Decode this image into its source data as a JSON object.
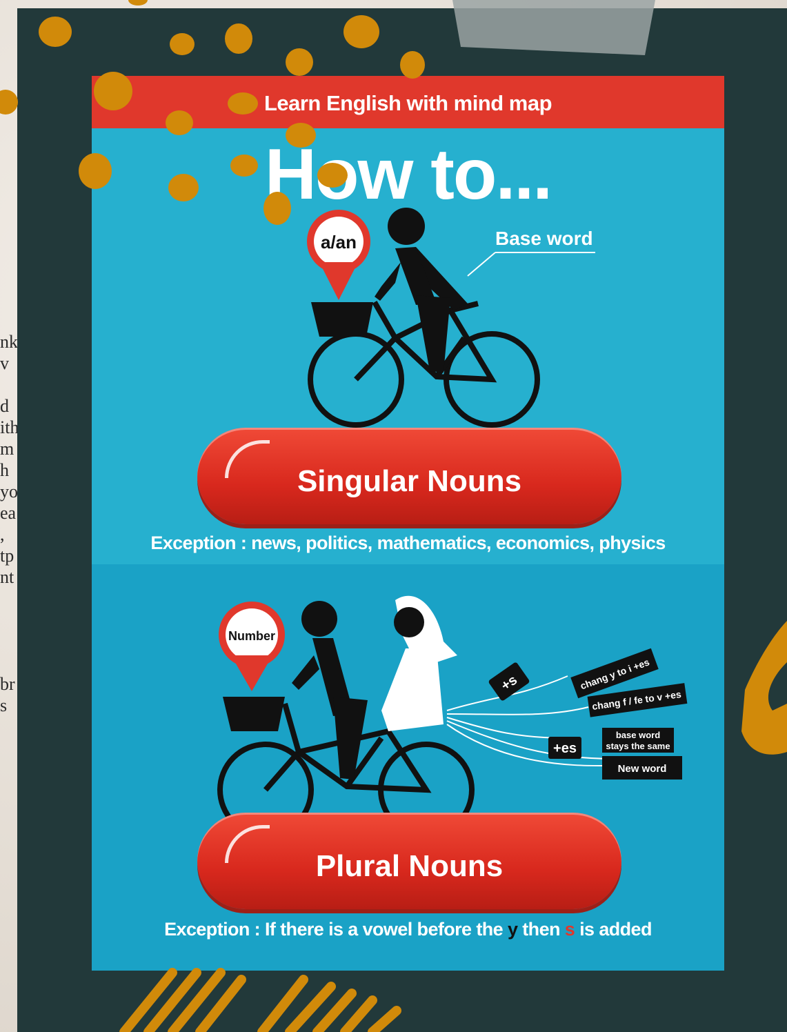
{
  "banner": {
    "title": "Learn English with mind map"
  },
  "heading": "How to...",
  "singular": {
    "pin_label": "a/an",
    "base_word_label": "Base word",
    "pill_label": "Singular  Nouns",
    "exception": "Exception : news, politics, mathematics, economics, physics"
  },
  "plural": {
    "pin_label": "Number",
    "pill_label": "Plural  Nouns",
    "tags": {
      "plus_s": "+s",
      "plus_es": "+es",
      "change_y": "chang y to i +es",
      "change_f": "chang f / fe to v +es",
      "base_same_line1": "base word",
      "base_same_line2": "stays the same",
      "new_word": "New word"
    },
    "exception_prefix": "Exception : If there is a vowel before the ",
    "exception_y": "y",
    "exception_mid": " then ",
    "exception_s": "s",
    "exception_suffix": " is added"
  },
  "background_text": [
    "nk",
    "v",
    "",
    "d",
    "ith",
    "m",
    "h",
    "yo",
    "ea",
    ",",
    "tp",
    "nt",
    "",
    "",
    "",
    "",
    "br",
    "s"
  ],
  "colors": {
    "frame": "#22393a",
    "poster_top": "#26b0cf",
    "poster_bottom": "#1aa2c6",
    "banner": "#e0382c",
    "accent_orange": "#d18a0a"
  }
}
